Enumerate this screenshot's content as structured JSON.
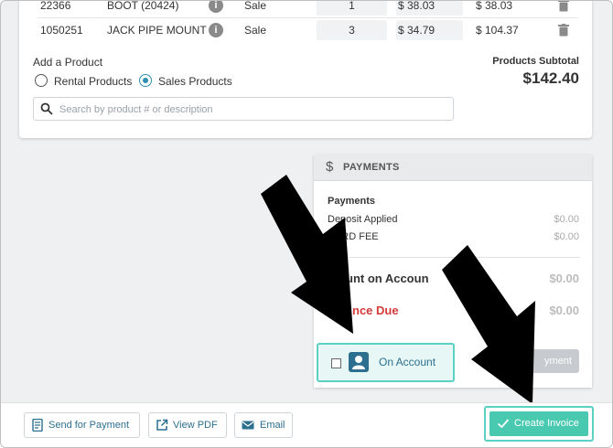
{
  "products": {
    "rows": [
      {
        "number": "22366",
        "description": "BOOT (20424)",
        "type": "Sale",
        "qty": "1",
        "price": "$ 38.03",
        "total": "$ 38.03"
      },
      {
        "number": "1050251",
        "description": "JACK PIPE MOUNT",
        "type": "Sale",
        "qty": "3",
        "price": "$ 34.79",
        "total": "$ 104.37"
      }
    ],
    "add_title": "Add a Product",
    "rental_label": "Rental Products",
    "sales_label": "Sales Products",
    "search_placeholder": "Search by product # or description",
    "subtotal_label": "Products Subtotal",
    "subtotal_value": "$142.40"
  },
  "payments": {
    "header_icon": "$",
    "header_title": "PAYMENTS",
    "section_title": "Payments",
    "deposit_label": "Deposit Applied",
    "deposit_value": "$0.00",
    "card_fee_label": "CARD FEE",
    "card_fee_value": "$0.00",
    "account_label": "unt on Accoun",
    "account_value": "$0.00",
    "balance_label": "nce Due",
    "balance_value": "$0.00",
    "payment_button_label": "yment"
  },
  "on_account": {
    "label": "On Account"
  },
  "footer": {
    "send_label": "Send for Payment",
    "pdf_label": "View PDF",
    "email_label": "Email",
    "create_label": "Create Invoice"
  },
  "colors": {
    "accent": "#2d6f8f",
    "teal": "#48c9b0",
    "highlight": "#5ad1c2",
    "danger": "#d33a3a"
  }
}
